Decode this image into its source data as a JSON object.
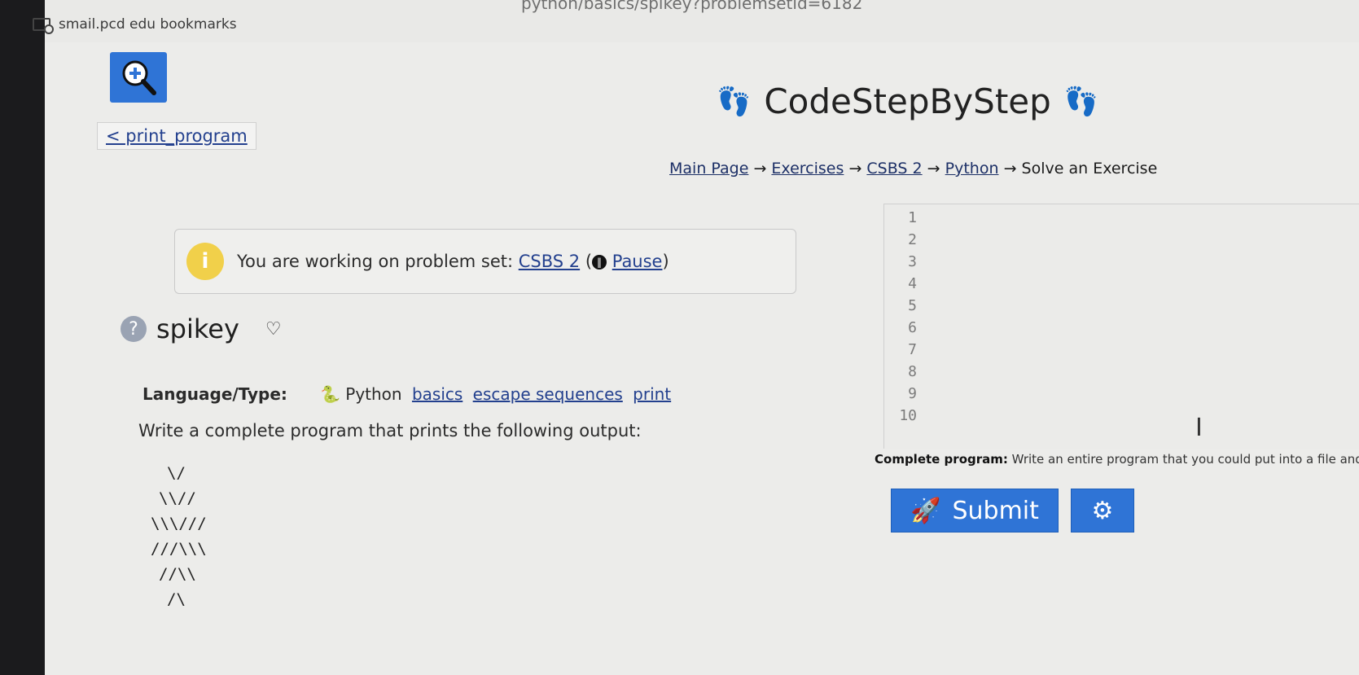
{
  "browser": {
    "url_fragment": "python/basics/spikey?problemsetid=6182",
    "bookmarks_label": "smail.pcd edu bookmarks"
  },
  "site": {
    "title": "CodeStepByStep"
  },
  "nav": {
    "back_link": "< print_program",
    "breadcrumb": {
      "items": [
        "Main Page",
        "Exercises",
        "CSBS 2",
        "Python"
      ],
      "current": "Solve an Exercise",
      "separator": "→"
    }
  },
  "notice": {
    "prefix": "You are working on problem set: ",
    "set_name": "CSBS 2",
    "pause_label": "Pause"
  },
  "problem": {
    "name": "spikey",
    "language_label": "Language/Type:",
    "language": "Python",
    "tags": [
      "basics",
      "escape sequences",
      "print"
    ],
    "prompt": "Write a complete program that prints the following output:",
    "expected_output": [
      "\\/",
      "\\\\//",
      "\\\\\\///",
      "///\\\\\\",
      "//\\\\",
      "/\\"
    ]
  },
  "editor": {
    "line_numbers": [
      "1",
      "2",
      "3",
      "4",
      "5",
      "6",
      "7",
      "8",
      "9",
      "10"
    ],
    "footer_label": "Complete program:",
    "footer_text": " Write an entire program that you could put into a file and run c"
  },
  "actions": {
    "submit_label": "Submit"
  },
  "colors": {
    "accent": "#2f74d6",
    "notice_icon": "#f1d04a",
    "link": "#23408e"
  }
}
